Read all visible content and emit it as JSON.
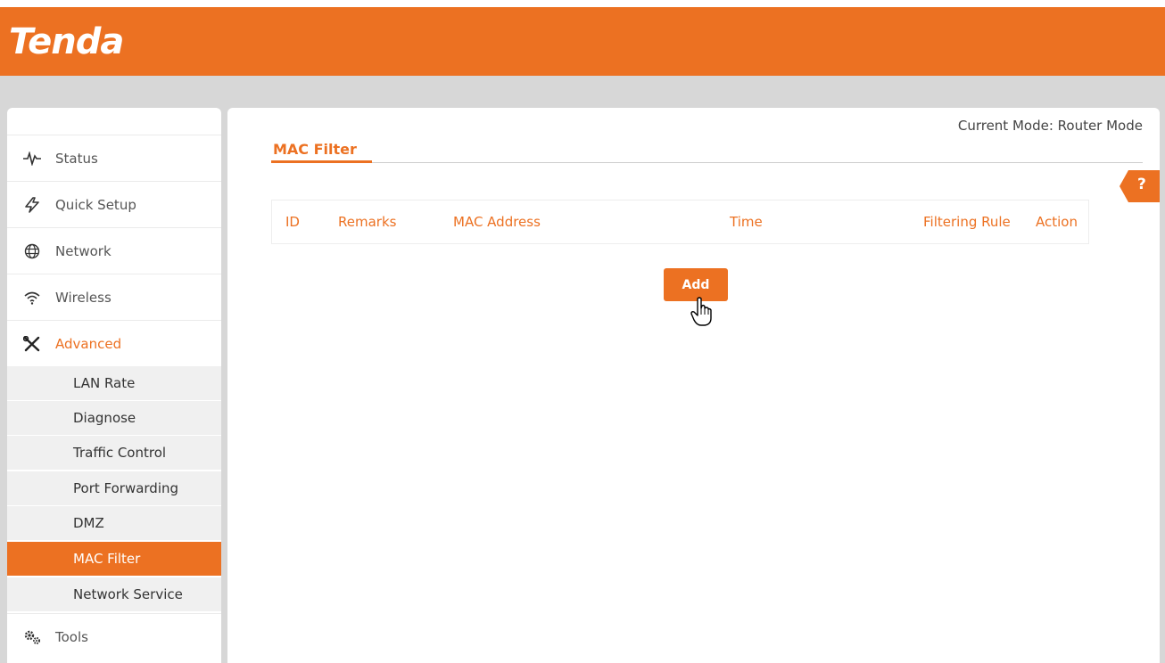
{
  "brand": {
    "logo_text": "Tenda",
    "accent_color": "#ec7122"
  },
  "main": {
    "current_mode": "Current Mode: Router Mode",
    "page_title": "MAC Filter",
    "help_label": "?",
    "table": {
      "headers": [
        "ID",
        "Remarks",
        "MAC Address",
        "Time",
        "Filtering Rule",
        "Action"
      ],
      "rows": []
    },
    "add_label": "Add"
  },
  "sidebar": {
    "items": [
      {
        "label": "Status",
        "icon": "pulse-icon"
      },
      {
        "label": "Quick Setup",
        "icon": "lightning-icon"
      },
      {
        "label": "Network",
        "icon": "globe-icon"
      },
      {
        "label": "Wireless",
        "icon": "wifi-icon"
      },
      {
        "label": "Advanced",
        "icon": "tools-icon",
        "expanded": true
      },
      {
        "label": "Tools",
        "icon": "gears-icon"
      }
    ],
    "subitems": [
      {
        "label": "LAN Rate"
      },
      {
        "label": "Diagnose"
      },
      {
        "label": "Traffic Control"
      },
      {
        "label": "Port Forwarding"
      },
      {
        "label": "DMZ"
      },
      {
        "label": "MAC Filter",
        "selected": true
      },
      {
        "label": "Network Service"
      }
    ]
  }
}
